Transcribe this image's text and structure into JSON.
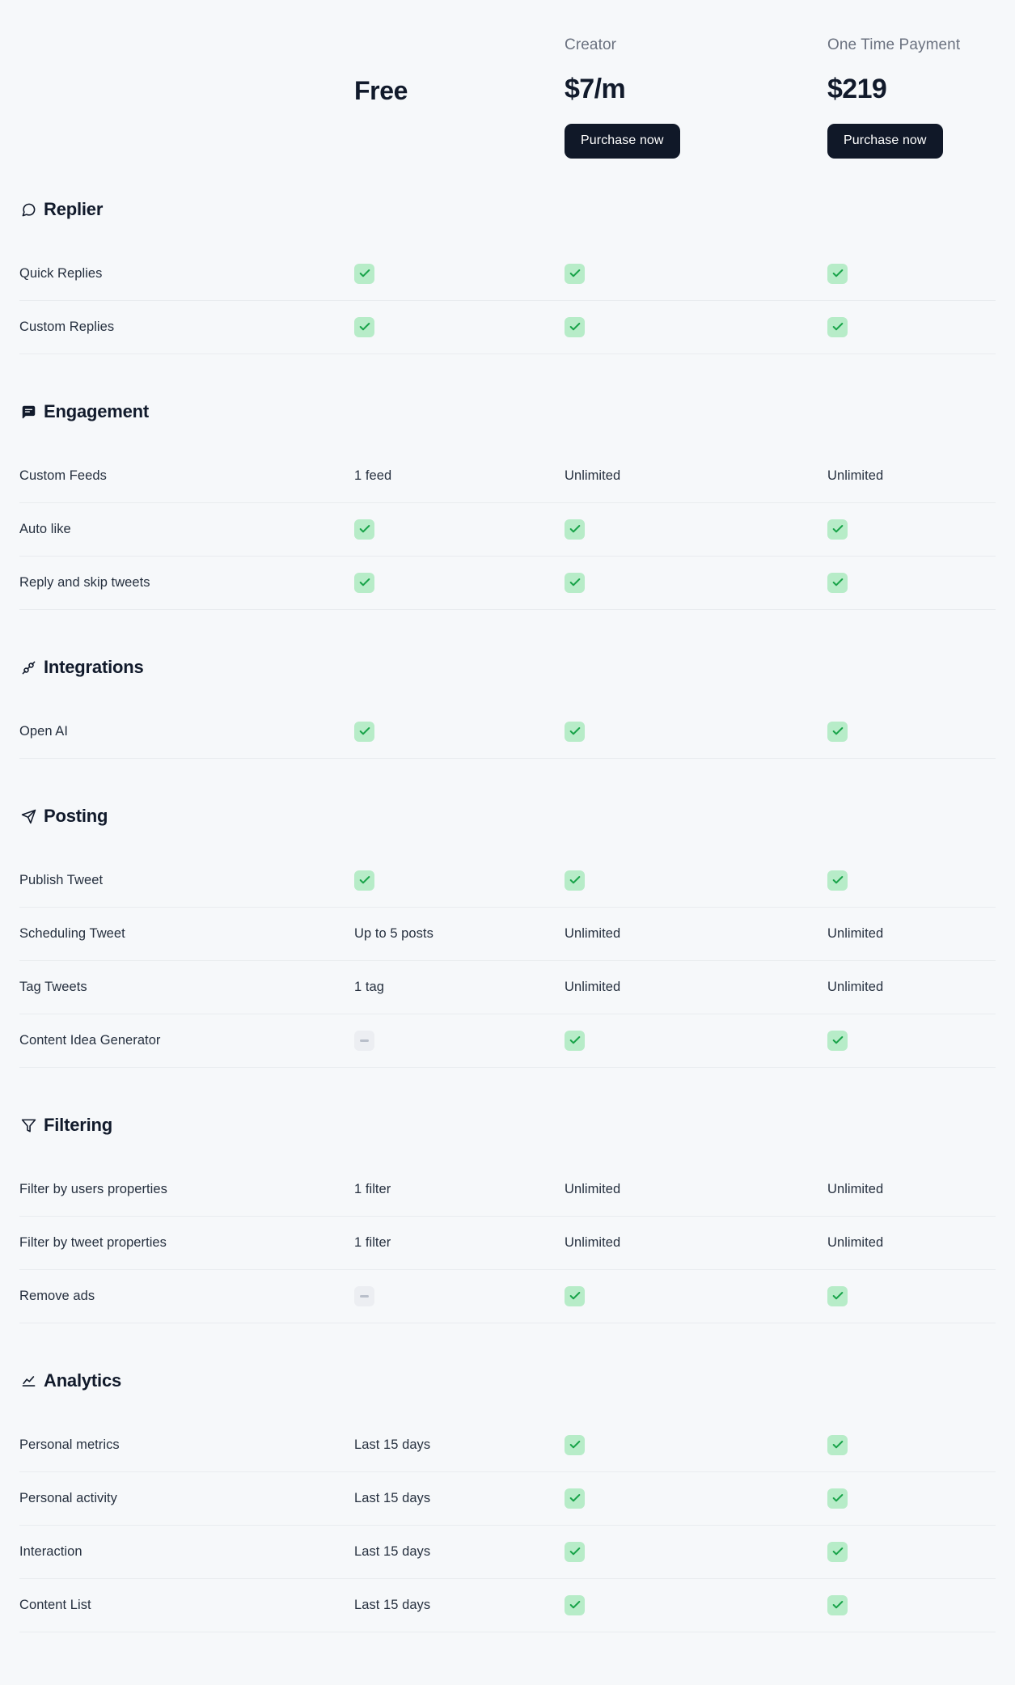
{
  "colors": {
    "page_background": "#f6f8fa",
    "button_background": "#101828",
    "check_background": "#b7ecc8",
    "check_mark": "#18a349",
    "dash_background": "#eceef2",
    "dash_mark": "#b9bfca",
    "row_divider": "#e9ecef",
    "heading_text": "#111a2b",
    "body_text": "#26303f",
    "muted_text": "#6b7280"
  },
  "plans": [
    {
      "id": "free",
      "name": "",
      "price": "Free",
      "has_button": false,
      "button_label": ""
    },
    {
      "id": "creator",
      "name": "Creator",
      "price": "$7/m",
      "has_button": true,
      "button_label": "Purchase now"
    },
    {
      "id": "one-time-payment",
      "name": "One Time Payment",
      "price": "$219",
      "has_button": true,
      "button_label": "Purchase now"
    }
  ],
  "sections": [
    {
      "id": "replier",
      "title": "Replier",
      "icon": "speech-bubble-icon",
      "rows": [
        {
          "name": "Quick Replies",
          "free": "check",
          "creator": "check",
          "onetime": "check"
        },
        {
          "name": "Custom Replies",
          "free": "check",
          "creator": "check",
          "onetime": "check"
        }
      ]
    },
    {
      "id": "engagement",
      "title": "Engagement",
      "icon": "message-square-icon",
      "rows": [
        {
          "name": "Custom Feeds",
          "free": "1 feed",
          "creator": "Unlimited",
          "onetime": "Unlimited"
        },
        {
          "name": "Auto like",
          "free": "check",
          "creator": "check",
          "onetime": "check"
        },
        {
          "name": "Reply and skip tweets",
          "free": "check",
          "creator": "check",
          "onetime": "check"
        }
      ]
    },
    {
      "id": "integrations",
      "title": "Integrations",
      "icon": "plug-connector-icon",
      "rows": [
        {
          "name": "Open AI",
          "free": "check",
          "creator": "check",
          "onetime": "check"
        }
      ]
    },
    {
      "id": "posting",
      "title": "Posting",
      "icon": "paper-plane-icon",
      "rows": [
        {
          "name": "Publish Tweet",
          "free": "check",
          "creator": "check",
          "onetime": "check"
        },
        {
          "name": "Scheduling Tweet",
          "free": "Up to 5 posts",
          "creator": "Unlimited",
          "onetime": "Unlimited"
        },
        {
          "name": "Tag Tweets",
          "free": "1 tag",
          "creator": "Unlimited",
          "onetime": "Unlimited"
        },
        {
          "name": "Content Idea Generator",
          "free": "dash",
          "creator": "check",
          "onetime": "check"
        }
      ]
    },
    {
      "id": "filtering",
      "title": "Filtering",
      "icon": "funnel-icon",
      "rows": [
        {
          "name": "Filter by users properties",
          "free": "1 filter",
          "creator": "Unlimited",
          "onetime": "Unlimited"
        },
        {
          "name": "Filter by tweet properties",
          "free": "1 filter",
          "creator": "Unlimited",
          "onetime": "Unlimited"
        },
        {
          "name": "Remove ads",
          "free": "dash",
          "creator": "check",
          "onetime": "check"
        }
      ]
    },
    {
      "id": "analytics",
      "title": "Analytics",
      "icon": "line-chart-icon",
      "rows": [
        {
          "name": "Personal metrics",
          "free": "Last 15 days",
          "creator": "check",
          "onetime": "check"
        },
        {
          "name": "Personal activity",
          "free": "Last 15 days",
          "creator": "check",
          "onetime": "check"
        },
        {
          "name": "Interaction",
          "free": "Last 15 days",
          "creator": "check",
          "onetime": "check"
        },
        {
          "name": "Content List",
          "free": "Last 15 days",
          "creator": "check",
          "onetime": "check"
        }
      ]
    }
  ]
}
